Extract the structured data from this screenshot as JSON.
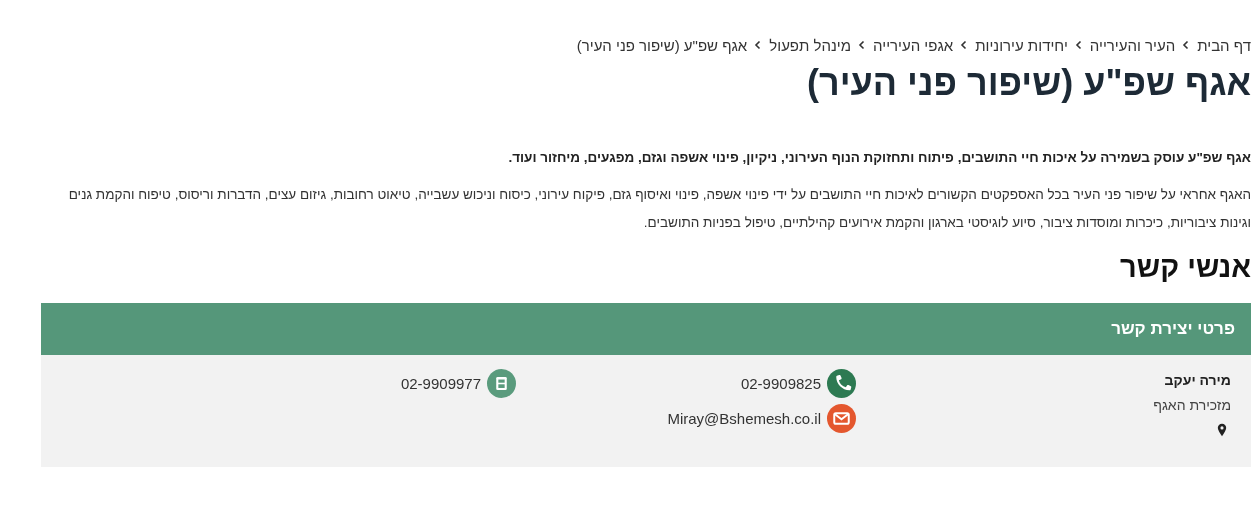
{
  "breadcrumbs": [
    {
      "label": "דף הבית"
    },
    {
      "label": "העיר והעירייה"
    },
    {
      "label": "יחידות עירוניות"
    },
    {
      "label": "אגפי העירייה"
    },
    {
      "label": "מינהל תפעול"
    },
    {
      "label": "אגף שפ\"ע (שיפור פני העיר)"
    }
  ],
  "title": "אגף שפ\"ע (שיפור פני העיר)",
  "intro": "אגף שפ\"ע עוסק בשמירה על איכות חיי התושבים, פיתוח ותחזוקת הנוף העירוני, ניקיון, פינוי אשפה וגזם, מפגעים, מיחזור ועוד.",
  "description": "האגף אחראי על שיפור פני העיר בכל האספקטים הקשורים לאיכות חיי התושבים  על ידי פינוי אשפה, פינוי ואיסוף גזם, פיקוח עירוני, כיסוח וניכוש עשבייה, טיאוט רחובות, גיזום עצים, הדברות וריסוס, טיפוח והקמת גנים וגינות ציבוריות, כיכרות ומוסדות ציבור, סיוע לוגיסטי  בארגון  והקמת אירועים קהילתיים, טיפול בפניות התושבים.",
  "contacts_heading": "אנשי קשר",
  "contact_panel": {
    "title": "פרטי יצירת קשר",
    "contacts": [
      {
        "name": "מירה יעקב",
        "role": "מזכירת האגף",
        "columns": [
          [
            {
              "kind": "phone",
              "value": "02-9909825"
            },
            {
              "kind": "email",
              "value": "Miray@Bshemesh.co.il"
            }
          ],
          [
            {
              "kind": "fax",
              "value": "02-9909977"
            }
          ]
        ]
      }
    ]
  }
}
